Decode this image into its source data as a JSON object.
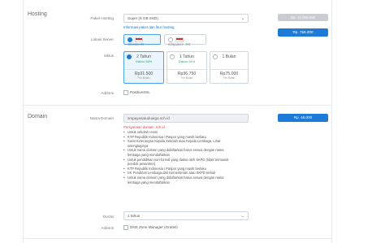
{
  "hosting": {
    "section_title": "Hosting",
    "paket_label": "Paket Hosting",
    "paket_value": "Super (5 GB SSD)",
    "paket_link": "Informasi paket dan fitur hosting",
    "price_old": "Rp. 10.000.000",
    "price_new": "Rp. 756.000",
    "lokasi_label": "Lokasi Server",
    "locations": [
      {
        "label": "Jakarta, ID",
        "selected": true
      },
      {
        "label": "Singapore, SG",
        "selected": false
      }
    ],
    "siklus_label": "Siklus",
    "terms": [
      {
        "title": "2 Tahun",
        "discount": "Diskon 58%",
        "price": "Rp31.500",
        "per": "Per Bulan",
        "selected": true
      },
      {
        "title": "1 Tahun",
        "discount": "Diskon 51%",
        "price": "Rp36.750",
        "per": "Per Bulan",
        "selected": false
      },
      {
        "title": "1 Bulan",
        "discount": "",
        "price": "Rp75.000",
        "per": "Per Bulan",
        "selected": false
      }
    ],
    "addons_label": "Addons",
    "addon_positivessl": "PositiveSSL"
  },
  "domain": {
    "section_title": "Domain",
    "nama_label": "Nama Domain",
    "nama_value": "smpayasatuduaiga.sch.id",
    "price": "Rp. 45.000",
    "error": "Persyaratan domain .sch.id",
    "requirements": [
      {
        "text": "Untuk sekolah resmi",
        "bullet": true
      },
      {
        "text": "KTP Republik Indonesia / Paspor yang masih berlaku",
        "bullet": true
      },
      {
        "text": "Surat Keterangan Kepala Sekolah atau Kepala Lembaga. Lihat",
        "bullet": true
      },
      {
        "text": "selengkapnya",
        "bullet": false,
        "link": true
      },
      {
        "text": "Untuk nama domain yang didaftarkan harus sesuai dengan nama",
        "bullet": true
      },
      {
        "text": "lembaga yang mendaftarkan",
        "bullet": false
      },
      {
        "text": "Untuk pendidikan non-formal yang diakui oleh SKPD (tidak termasuk",
        "bullet": true
      },
      {
        "text": "pondok pesantren)",
        "bullet": false
      },
      {
        "text": "KTP Republik Indonesia / Paspor yang masih berlaku",
        "bullet": true
      },
      {
        "text": "SK Pendirian Lembaga dari Kementerian atau SKPD terkait",
        "bullet": true
      },
      {
        "text": "Untuk nama domain yang didaftarkan harus sesuai dengan nama",
        "bullet": true
      },
      {
        "text": "lembaga yang mendaftarkan",
        "bullet": false
      }
    ],
    "durasi_label": "Durasi",
    "durasi_value": "1 tahun",
    "addons_label": "Addons",
    "addon_dns": "DNS Zone Manager (Gratis!)"
  }
}
